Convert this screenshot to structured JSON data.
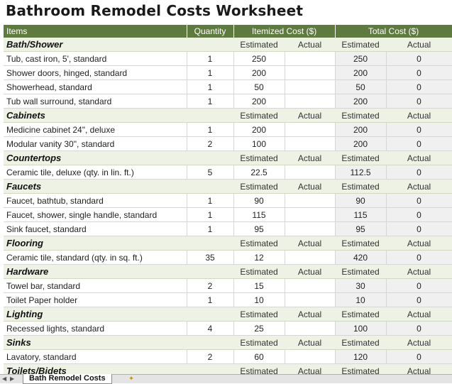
{
  "title": "Bathroom Remodel Costs Worksheet",
  "header": {
    "items": "Items",
    "quantity": "Quantity",
    "itemized": "Itemized Cost ($)",
    "total": "Total Cost ($)"
  },
  "labels": {
    "estimated": "Estimated",
    "actual": "Actual"
  },
  "categories": [
    {
      "name": "Bath/Shower",
      "items": [
        {
          "name": "Tub, cast iron, 5', standard",
          "qty": "1",
          "est": "250",
          "act": "",
          "tot_est": "250",
          "tot_act": "0"
        },
        {
          "name": "Shower doors, hinged, standard",
          "qty": "1",
          "est": "200",
          "act": "",
          "tot_est": "200",
          "tot_act": "0"
        },
        {
          "name": "Showerhead, standard",
          "qty": "1",
          "est": "50",
          "act": "",
          "tot_est": "50",
          "tot_act": "0"
        },
        {
          "name": "Tub wall surround, standard",
          "qty": "1",
          "est": "200",
          "act": "",
          "tot_est": "200",
          "tot_act": "0"
        }
      ]
    },
    {
      "name": "Cabinets",
      "items": [
        {
          "name": "Medicine cabinet 24\", deluxe",
          "qty": "1",
          "est": "200",
          "act": "",
          "tot_est": "200",
          "tot_act": "0"
        },
        {
          "name": "Modular vanity 30\", standard",
          "qty": "2",
          "est": "100",
          "act": "",
          "tot_est": "200",
          "tot_act": "0"
        }
      ]
    },
    {
      "name": "Countertops",
      "items": [
        {
          "name": "Ceramic tile, deluxe (qty. in lin. ft.)",
          "qty": "5",
          "est": "22.5",
          "act": "",
          "tot_est": "112.5",
          "tot_act": "0"
        }
      ]
    },
    {
      "name": "Faucets",
      "items": [
        {
          "name": "Faucet, bathtub, standard",
          "qty": "1",
          "est": "90",
          "act": "",
          "tot_est": "90",
          "tot_act": "0"
        },
        {
          "name": "Faucet, shower, single handle, standard",
          "qty": "1",
          "est": "115",
          "act": "",
          "tot_est": "115",
          "tot_act": "0"
        },
        {
          "name": "Sink faucet, standard",
          "qty": "1",
          "est": "95",
          "act": "",
          "tot_est": "95",
          "tot_act": "0"
        }
      ]
    },
    {
      "name": "Flooring",
      "items": [
        {
          "name": "Ceramic tile, standard (qty. in sq. ft.)",
          "qty": "35",
          "est": "12",
          "act": "",
          "tot_est": "420",
          "tot_act": "0"
        }
      ]
    },
    {
      "name": "Hardware",
      "items": [
        {
          "name": "Towel bar, standard",
          "qty": "2",
          "est": "15",
          "act": "",
          "tot_est": "30",
          "tot_act": "0"
        },
        {
          "name": "Toilet Paper holder",
          "qty": "1",
          "est": "10",
          "act": "",
          "tot_est": "10",
          "tot_act": "0"
        }
      ]
    },
    {
      "name": "Lighting",
      "items": [
        {
          "name": "Recessed lights, standard",
          "qty": "4",
          "est": "25",
          "act": "",
          "tot_est": "100",
          "tot_act": "0"
        }
      ]
    },
    {
      "name": "Sinks",
      "items": [
        {
          "name": "Lavatory, standard",
          "qty": "2",
          "est": "60",
          "act": "",
          "tot_est": "120",
          "tot_act": "0"
        }
      ]
    },
    {
      "name": "Toilets/Bidets",
      "items": []
    }
  ],
  "tabs": {
    "active": "Bath Remodel Costs"
  },
  "colors": {
    "header": "#5e7a3f",
    "category_row": "#eef2e4",
    "total_col": "#f0f0f0"
  }
}
